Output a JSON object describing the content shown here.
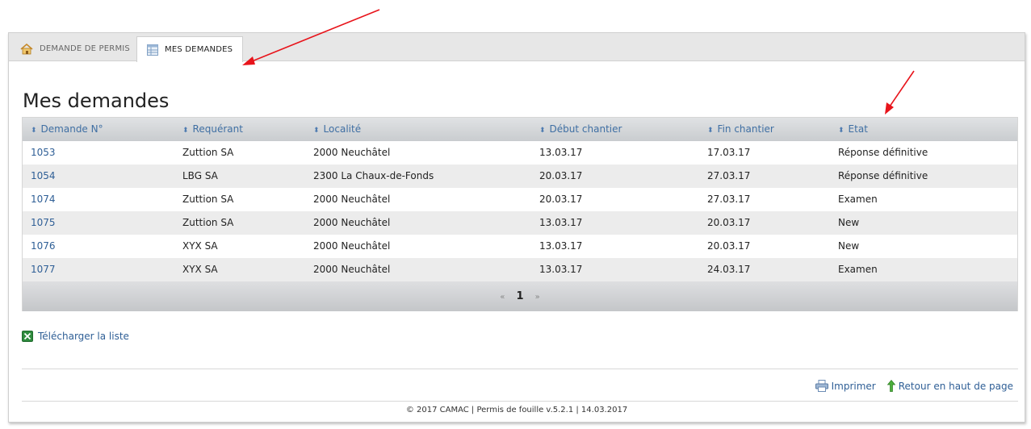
{
  "tabs": [
    {
      "label": "DEMANDE DE PERMIS",
      "icon": "home-icon"
    },
    {
      "label": "MES DEMANDES",
      "icon": "table-icon"
    }
  ],
  "page_title": "Mes demandes",
  "table": {
    "columns": [
      "Demande N°",
      "Requérant",
      "Localité",
      "Début chantier",
      "Fin chantier",
      "Etat"
    ],
    "rows": [
      {
        "id": "1053",
        "requerant": "Zuttion SA",
        "localite": "2000 Neuchâtel",
        "debut": "13.03.17",
        "fin": "17.03.17",
        "etat": "Réponse définitive"
      },
      {
        "id": "1054",
        "requerant": "LBG SA",
        "localite": "2300 La Chaux-de-Fonds",
        "debut": "20.03.17",
        "fin": "27.03.17",
        "etat": "Réponse définitive"
      },
      {
        "id": "1074",
        "requerant": "Zuttion SA",
        "localite": "2000 Neuchâtel",
        "debut": "20.03.17",
        "fin": "27.03.17",
        "etat": "Examen"
      },
      {
        "id": "1075",
        "requerant": "Zuttion SA",
        "localite": "2000 Neuchâtel",
        "debut": "13.03.17",
        "fin": "20.03.17",
        "etat": "New"
      },
      {
        "id": "1076",
        "requerant": "XYX SA",
        "localite": "2000 Neuchâtel",
        "debut": "13.03.17",
        "fin": "20.03.17",
        "etat": "New"
      },
      {
        "id": "1077",
        "requerant": "XYX SA",
        "localite": "2000 Neuchâtel",
        "debut": "13.03.17",
        "fin": "24.03.17",
        "etat": "Examen"
      }
    ]
  },
  "pager": {
    "prev": "«",
    "current": "1",
    "next": "»"
  },
  "download_label": "Télécharger la liste",
  "actions": {
    "print": "Imprimer",
    "back_to_top": "Retour en haut de page"
  },
  "footer": "© 2017 CAMAC | Permis de fouille v.5.2.1 | 14.03.2017",
  "colors": {
    "link": "#2f5f96",
    "annotation_arrow": "#e8141b"
  }
}
